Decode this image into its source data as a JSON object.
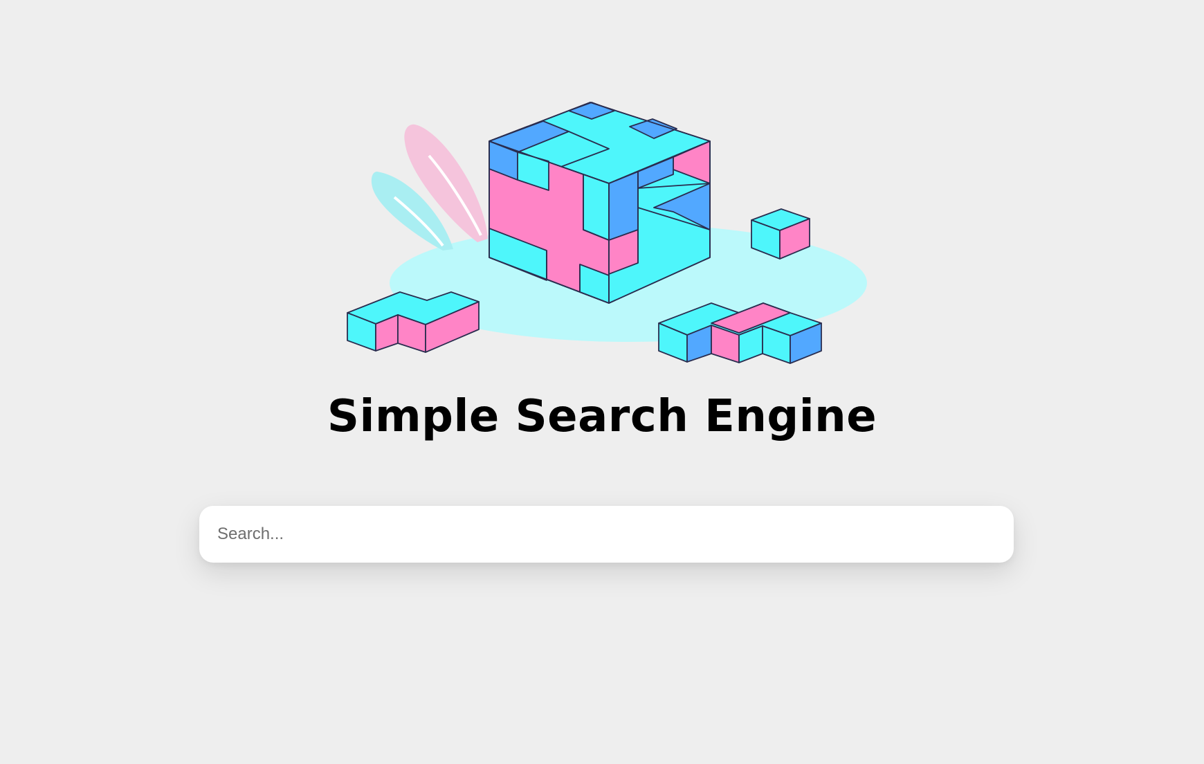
{
  "page": {
    "title": "Simple Search Engine"
  },
  "hero": {
    "illustration": "isometric-puzzle-cubes-illustration",
    "colors": {
      "cyan": "#4ef6fb",
      "blue": "#52a8ff",
      "pink": "#ff84c6",
      "outline": "#2a2d4f",
      "floor": "#bbf9fb",
      "leaf_pink": "#f5c4dc",
      "leaf_cyan": "#a9eef2"
    }
  },
  "search": {
    "placeholder": "Search...",
    "value": ""
  }
}
